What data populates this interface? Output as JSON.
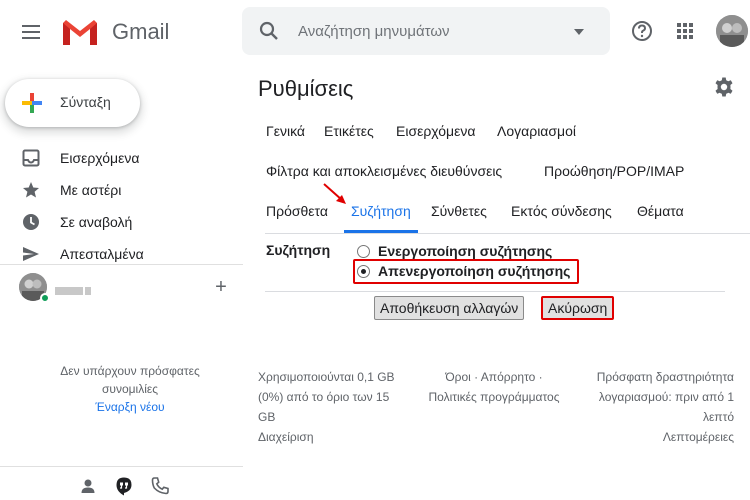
{
  "app": {
    "name": "Gmail"
  },
  "search": {
    "placeholder": "Αναζήτηση μηνυμάτων"
  },
  "sidebar": {
    "compose_label": "Σύνταξη",
    "items": [
      {
        "label": "Εισερχόμενα",
        "icon": "inbox-icon"
      },
      {
        "label": "Με αστέρι",
        "icon": "star-icon"
      },
      {
        "label": "Σε αναβολή",
        "icon": "clock-icon"
      },
      {
        "label": "Απεσταλμένα",
        "icon": "send-icon"
      }
    ],
    "hangouts": {
      "empty_line1": "Δεν υπάρχουν πρόσφατες",
      "empty_line2": "συνομιλίες",
      "start_new": "Έναρξη νέου"
    }
  },
  "settings": {
    "title": "Ρυθμίσεις",
    "tabs_row1": [
      "Γενικά",
      "Ετικέτες",
      "Εισερχόμενα",
      "Λογαριασμοί"
    ],
    "tabs_row2": [
      "Φίλτρα και αποκλεισμένες διευθύνσεις",
      "Προώθηση/POP/IMAP"
    ],
    "tabs_row3": [
      "Πρόσθετα",
      "Συζήτηση",
      "Σύνθετες",
      "Εκτός σύνδεσης",
      "Θέματα"
    ],
    "active_tab": "Συζήτηση",
    "conversation": {
      "label": "Συζήτηση",
      "option_on": "Ενεργοποίηση συζήτησης",
      "option_off": "Απενεργοποίηση συζήτησης",
      "selected": "Απενεργοποίηση συζήτησης"
    },
    "save_button": "Αποθήκευση αλλαγών",
    "cancel_button": "Ακύρωση"
  },
  "footer": {
    "storage_line1": "Χρησιμοποιούνται 0,1 GB",
    "storage_line2": "(0%) από το όριο των 15",
    "storage_line3": "GB",
    "manage": "Διαχείριση",
    "terms_line1": "Όροι · Απόρρητο ·",
    "terms_line2": "Πολιτικές προγράμματος",
    "activity_line1": "Πρόσφατη δραστηριότητα",
    "activity_line2": "λογαριασμού: πριν από 1",
    "activity_line3": "λεπτό",
    "details": "Λεπτομέρειες"
  },
  "colors": {
    "accent": "#1a73e8",
    "highlight": "#e00000",
    "online": "#0f9d58"
  }
}
